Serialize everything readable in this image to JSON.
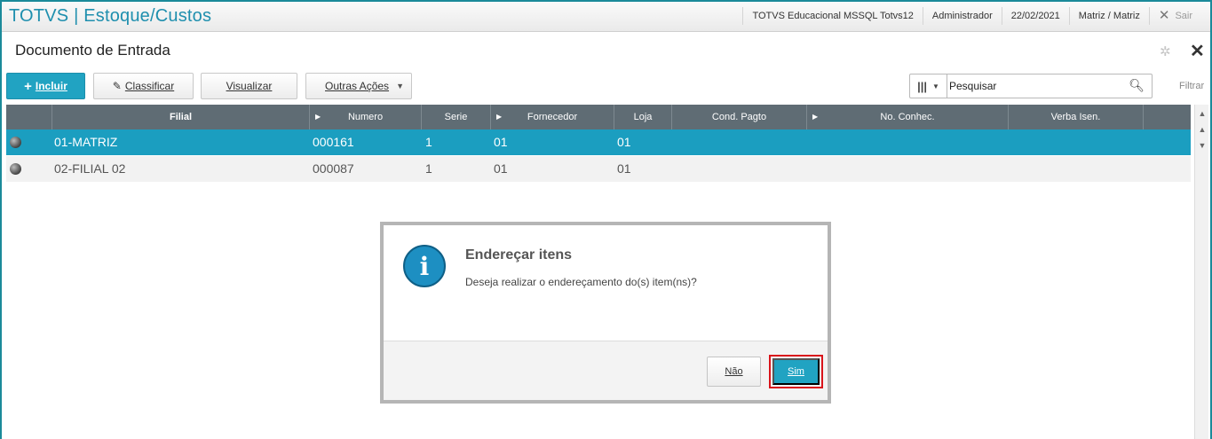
{
  "header": {
    "title": "TOTVS | Estoque/Custos",
    "environment": "TOTVS Educacional MSSQL Totvs12",
    "user": "Administrador",
    "date": "22/02/2021",
    "branch": "Matriz / Matriz",
    "exit_label": "Sair"
  },
  "page": {
    "title": "Documento de Entrada"
  },
  "toolbar": {
    "incluir": "Incluir",
    "classificar": "Classificar",
    "visualizar": "Visualizar",
    "outras": "Outras Ações"
  },
  "search": {
    "value": "Pesquisar",
    "filter_label": "Filtrar"
  },
  "grid": {
    "columns": [
      "Filial",
      "Numero",
      "Serie",
      "Fornecedor",
      "Loja",
      "Cond. Pagto",
      "No. Conhec.",
      "Verba Isen."
    ],
    "rows": [
      {
        "filial": "01-MATRIZ",
        "numero": "000161",
        "serie": "1",
        "fornecedor": "01",
        "loja": "01",
        "selected": true
      },
      {
        "filial": "02-FILIAL 02",
        "numero": "000087",
        "serie": "1",
        "fornecedor": "01",
        "loja": "01",
        "selected": false
      }
    ]
  },
  "dialog": {
    "title": "Endereçar itens",
    "message": "Deseja realizar o endereçamento do(s) item(ns)?",
    "no_label": "Não",
    "yes_label": "Sim"
  },
  "colors": {
    "accent": "#21a3c2",
    "header_text": "#1f8fae",
    "grid_header": "#5f6c74",
    "selected_row": "#1b9ec0",
    "highlight_border": "#d9141b"
  }
}
